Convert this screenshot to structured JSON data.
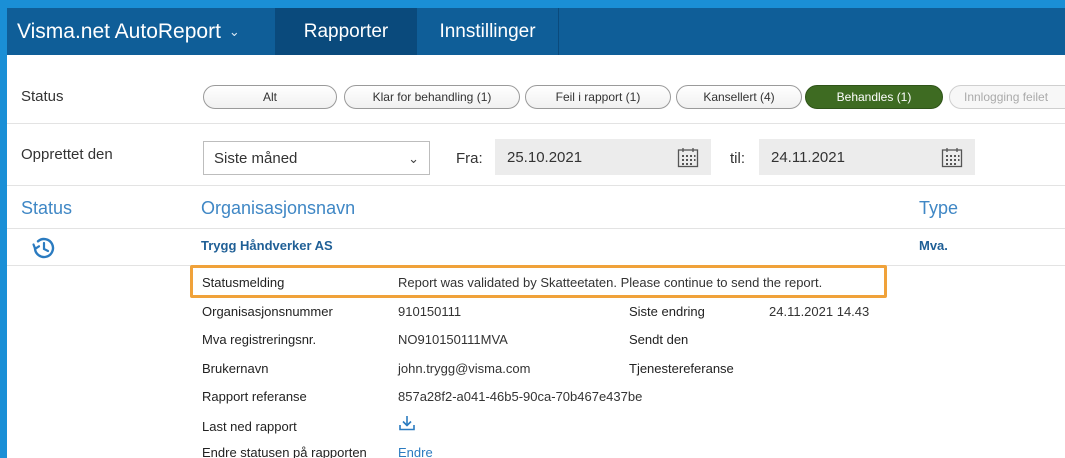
{
  "app": {
    "title": "Visma.net AutoReport",
    "tabs": [
      "Rapporter",
      "Innstillinger"
    ]
  },
  "filters": {
    "status_label": "Status",
    "pills": [
      "Alt",
      "Klar for behandling (1)",
      "Feil i rapport (1)",
      "Kansellert (4)",
      "Behandles (1)",
      "Innlogging feilet"
    ],
    "active_pill": "Behandles (1)",
    "created_label": "Opprettet den",
    "period_select": "Siste måned",
    "from_label": "Fra:",
    "from_date": "25.10.2021",
    "to_label": "til:",
    "to_date": "24.11.2021"
  },
  "table": {
    "headers": {
      "status": "Status",
      "org": "Organisasjonsnavn",
      "type": "Type"
    },
    "row": {
      "org_name": "Trygg Håndverker AS",
      "type": "Mva."
    }
  },
  "details": {
    "statusmelding_label": "Statusmelding",
    "statusmelding_value": "Report was validated by Skatteetaten. Please continue to send the report.",
    "orgnr_label": "Organisasjonsnummer",
    "orgnr_value": "910150111",
    "mva_label": "Mva registreringsnr.",
    "mva_value": "NO910150111MVA",
    "user_label": "Brukernavn",
    "user_value": "john.trygg@visma.com",
    "ref_label": "Rapport referanse",
    "ref_value": "857a28f2-a041-46b5-90ca-70b467e437be",
    "download_label": "Last ned rapport",
    "change_status_label": "Endre statusen på rapporten",
    "change_link": "Endre",
    "last_change_label": "Siste endring",
    "last_change_value": "24.11.2021 14.43",
    "sent_label": "Sendt den",
    "service_ref_label": "Tjenestereferanse"
  },
  "colors": {
    "accent": "#0f5e98",
    "active_pill": "#3e6b22",
    "highlight": "#f0a23a",
    "link": "#2b7bc0"
  }
}
